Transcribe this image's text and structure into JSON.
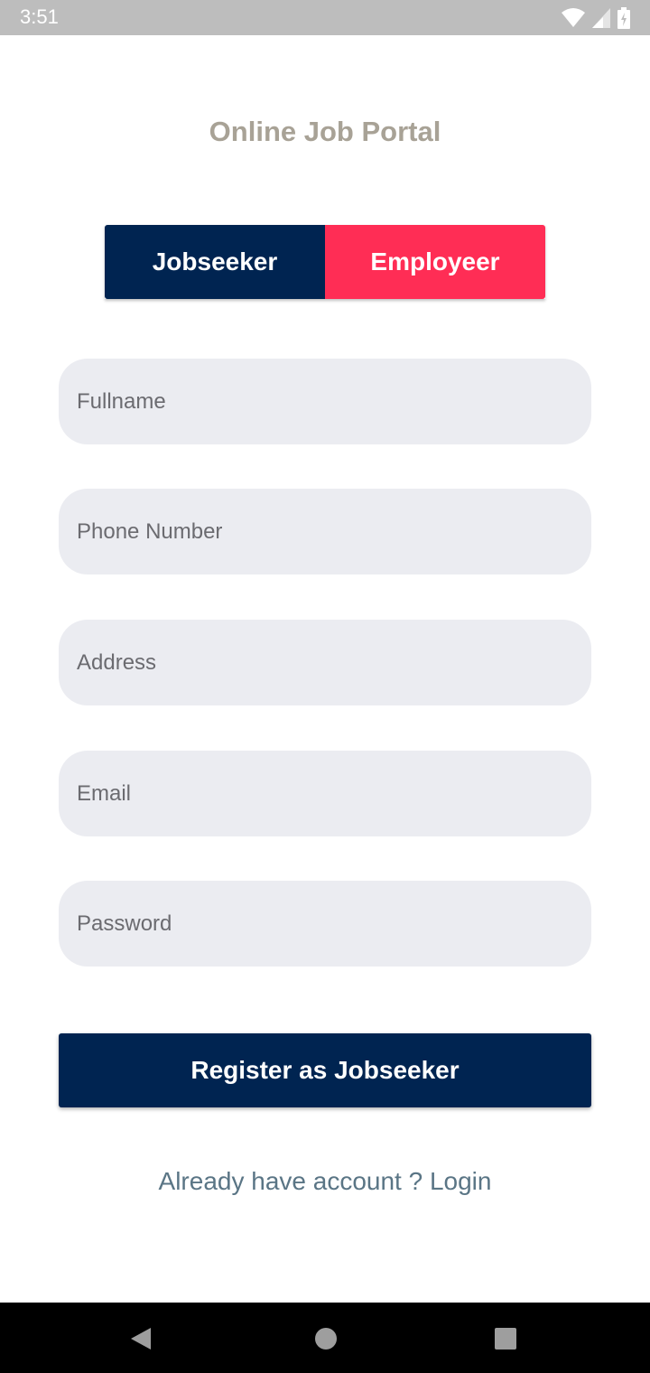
{
  "status_bar": {
    "time": "3:51",
    "icons": [
      "wifi-icon",
      "cell-signal-icon",
      "battery-charging-icon"
    ]
  },
  "app": {
    "title": "Online Job Portal"
  },
  "toggle": {
    "jobseeker_label": "Jobseeker",
    "employeer_label": "Employeer",
    "selected": "Jobseeker",
    "colors": {
      "jobseeker": "#002451",
      "employeer": "#ff2d55"
    }
  },
  "form": {
    "fullname": {
      "placeholder": "Fullname",
      "value": ""
    },
    "phone": {
      "placeholder": "Phone Number",
      "value": ""
    },
    "address": {
      "placeholder": "Address",
      "value": ""
    },
    "email": {
      "placeholder": "Email",
      "value": ""
    },
    "password": {
      "placeholder": "Password",
      "value": ""
    }
  },
  "actions": {
    "register_label": "Register as Jobseeker",
    "login_link": "Already have account ? Login"
  },
  "nav_bar": {
    "icons": [
      "back-icon",
      "home-icon",
      "recents-icon"
    ]
  }
}
